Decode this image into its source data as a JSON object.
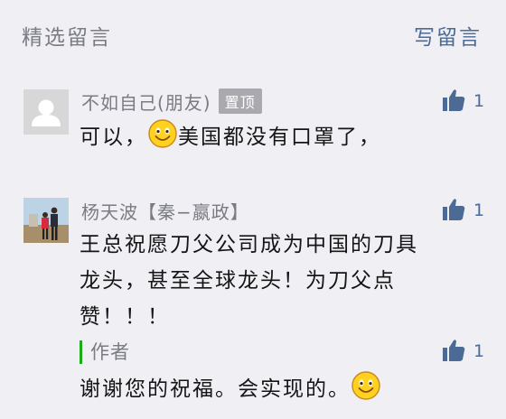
{
  "header": {
    "title": "精选留言",
    "write_label": "写留言"
  },
  "comments": [
    {
      "name": "不如自己(朋友)",
      "badge": "置顶",
      "text_before": "可以，",
      "text_after": "美国都没有口罩了，",
      "likes": "1"
    },
    {
      "name": "杨天波【秦−嬴政】",
      "text_lines": [
        "王总祝愿刀父公司成为中国的刀具",
        "龙头，甚至全球龙头！为刀父点",
        "赞！！！"
      ],
      "likes": "1",
      "reply": {
        "label": "作者",
        "text": "谢谢您的祝福。会实现的。",
        "likes": "1"
      }
    }
  ],
  "colors": {
    "link": "#4b6b96",
    "meta": "#7b7b84",
    "accent": "#1aad19",
    "background": "#efeff4"
  }
}
